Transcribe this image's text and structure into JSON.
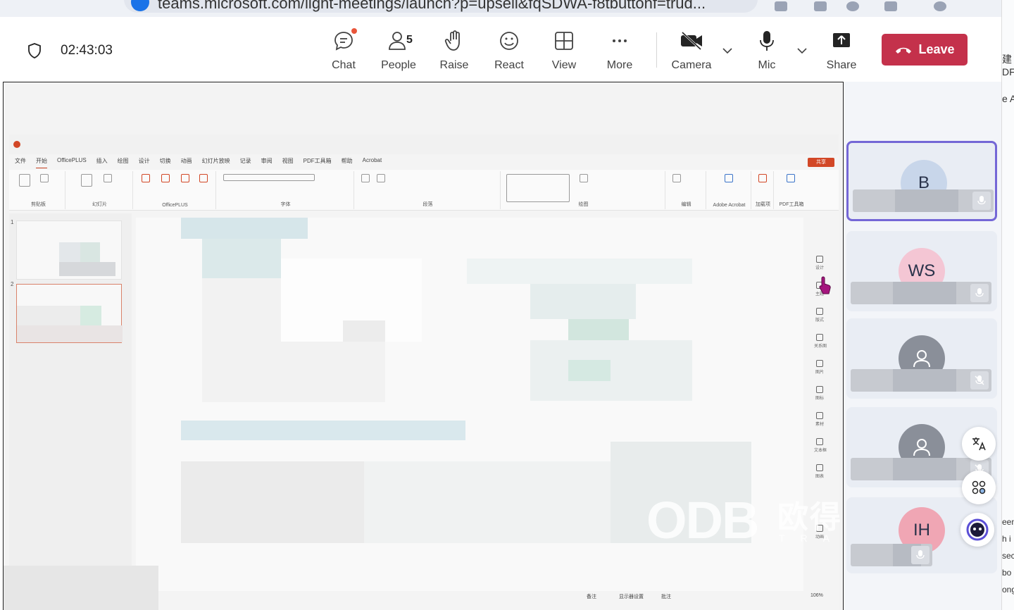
{
  "browser": {
    "url": "teams.microsoft.com/light-meetings/launch?p=upsell&fqSDWA-f8tbuttonf=trud..."
  },
  "toolbar": {
    "timer": "02:43:03",
    "chat_label": "Chat",
    "people_label": "People",
    "people_count": "5",
    "raise_label": "Raise",
    "react_label": "React",
    "view_label": "View",
    "more_label": "More",
    "camera_label": "Camera",
    "mic_label": "Mic",
    "share_label": "Share",
    "leave_label": "Leave"
  },
  "colors": {
    "leave": "#c4314b",
    "active_tile_border": "#7467d6",
    "ppt_accent": "#d24726"
  },
  "ppt": {
    "menu": [
      "文件",
      "开始",
      "OfficePLUS",
      "插入",
      "绘图",
      "设计",
      "切换",
      "动画",
      "幻灯片放映",
      "记录",
      "审阅",
      "视图",
      "PDF工具箱",
      "帮助",
      "Acrobat"
    ],
    "share_button": "共享",
    "ribbon_groups": [
      "剪贴板",
      "幻灯片",
      "OfficePLUS",
      "字体",
      "段落",
      "绘图",
      "编辑",
      "Adobe Acrobat",
      "加载项",
      "PDF工具箱"
    ],
    "thumb_numbers": [
      "1",
      "2"
    ],
    "side_tools": [
      "设计",
      "主题",
      "版式",
      "关系图",
      "图片",
      "图标",
      "素材",
      "文本框",
      "图表",
      "动画"
    ],
    "status": {
      "notes": "备注",
      "display": "显示器设置",
      "comments": "批注",
      "zoom": "106%"
    }
  },
  "watermark": {
    "logo": "ODB",
    "cn": "欧得宝翻译",
    "en": "TRANSLATION"
  },
  "participants": [
    {
      "initials": "B",
      "avatar_color": "#c8d6ea",
      "mic": "on"
    },
    {
      "initials": "WS",
      "avatar_color": "#f4c6d4",
      "mic": "on"
    },
    {
      "initials": "",
      "avatar_color": "#8a8f99",
      "mic": "off"
    },
    {
      "initials": "",
      "avatar_color": "#8a8f99",
      "mic": "off"
    },
    {
      "initials": "IH",
      "avatar_color": "#f0a6b4",
      "mic": "on"
    }
  ],
  "right_edge_text": [
    "建",
    "DF",
    "e A",
    "een",
    "h i",
    "sec",
    "bo",
    "ong"
  ]
}
